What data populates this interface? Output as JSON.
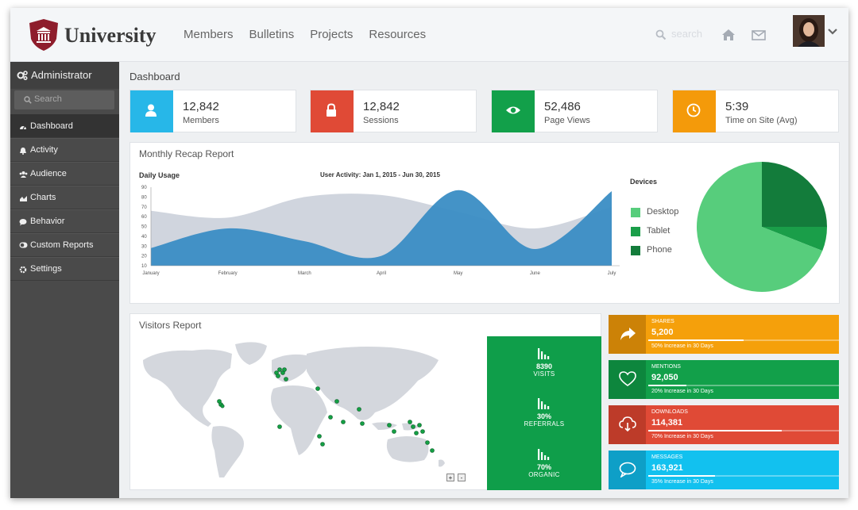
{
  "header": {
    "brand": "University",
    "nav": [
      "Members",
      "Bulletins",
      "Projects",
      "Resources"
    ],
    "search_placeholder": "search"
  },
  "sidebar": {
    "title": "Administrator",
    "search_placeholder": "Search",
    "items": [
      {
        "label": "Dashboard",
        "icon": "dashboard-icon",
        "active": true
      },
      {
        "label": "Activity",
        "icon": "bell-icon"
      },
      {
        "label": "Audience",
        "icon": "users-icon"
      },
      {
        "label": "Charts",
        "icon": "area-chart-icon"
      },
      {
        "label": "Behavior",
        "icon": "comment-icon"
      },
      {
        "label": "Custom Reports",
        "icon": "toggle-icon"
      },
      {
        "label": "Settings",
        "icon": "gear-icon"
      }
    ]
  },
  "page_title": "Dashboard",
  "stats": [
    {
      "value": "12,842",
      "label": "Members",
      "color": "#27b7e8",
      "icon": "user-icon"
    },
    {
      "value": "12,842",
      "label": "Sessions",
      "color": "#e04a36",
      "icon": "lock-icon"
    },
    {
      "value": "52,486",
      "label": "Page Views",
      "color": "#12a04a",
      "icon": "eye-icon"
    },
    {
      "value": "5:39",
      "label": "Time on Site (Avg)",
      "color": "#f49a0a",
      "icon": "clock-icon"
    }
  ],
  "recap": {
    "title": "Monthly Recap Report",
    "chart_label": "Daily Usage",
    "chart_subtitle": "User Activity: Jan 1, 2015 - Jun 30, 2015",
    "devices_title": "Devices"
  },
  "visitors": {
    "title": "Visitors Report",
    "stats": [
      {
        "value": "8390",
        "label": "VISITS"
      },
      {
        "value": "30%",
        "label": "REFERRALS"
      },
      {
        "value": "70%",
        "label": "ORGANIC"
      }
    ],
    "zoom_in": "+",
    "zoom_out": "-"
  },
  "social": [
    {
      "key": "SHARES",
      "value": "5,200",
      "sub": "50% Increase in 30 Days",
      "progress": 0.5,
      "color": "#f5a00b",
      "dark": "#cc8207",
      "icon": "share-icon"
    },
    {
      "key": "MENTIONS",
      "value": "92,050",
      "sub": "20% Increase in 30 Days",
      "progress": 0.2,
      "color": "#12a04a",
      "dark": "#0d863d",
      "icon": "heart-icon"
    },
    {
      "key": "DOWNLOADS",
      "value": "114,381",
      "sub": "70% Increase in 30 Days",
      "progress": 0.7,
      "color": "#e04a36",
      "dark": "#bd3b29",
      "icon": "cloud-download-icon"
    },
    {
      "key": "MESSAGES",
      "value": "163,921",
      "sub": "35% Increase in 30 Days",
      "progress": 0.35,
      "color": "#12c1ef",
      "dark": "#0e9fc7",
      "icon": "chat-icon"
    }
  ],
  "chart_data": [
    {
      "type": "area",
      "title": "User Activity: Jan 1, 2015 - Jun 30, 2015",
      "ylabel": "Daily Usage",
      "categories": [
        "January",
        "February",
        "March",
        "April",
        "May",
        "June",
        "July"
      ],
      "ylim": [
        10,
        90
      ],
      "yticks": [
        10,
        20,
        30,
        40,
        50,
        60,
        70,
        80,
        90
      ],
      "series": [
        {
          "values": [
            66,
            59,
            80,
            82,
            65,
            48,
            70
          ],
          "color": "#cbd0da"
        },
        {
          "values": [
            28,
            48,
            35,
            20,
            87,
            27,
            86
          ],
          "color": "#3a8dc4"
        }
      ]
    },
    {
      "type": "pie",
      "title": "Devices",
      "labels": [
        "Desktop",
        "Tablet",
        "Phone"
      ],
      "values": [
        69,
        6,
        25
      ],
      "colors": [
        "#57cd7c",
        "#1a9e49",
        "#137c3b"
      ]
    }
  ]
}
